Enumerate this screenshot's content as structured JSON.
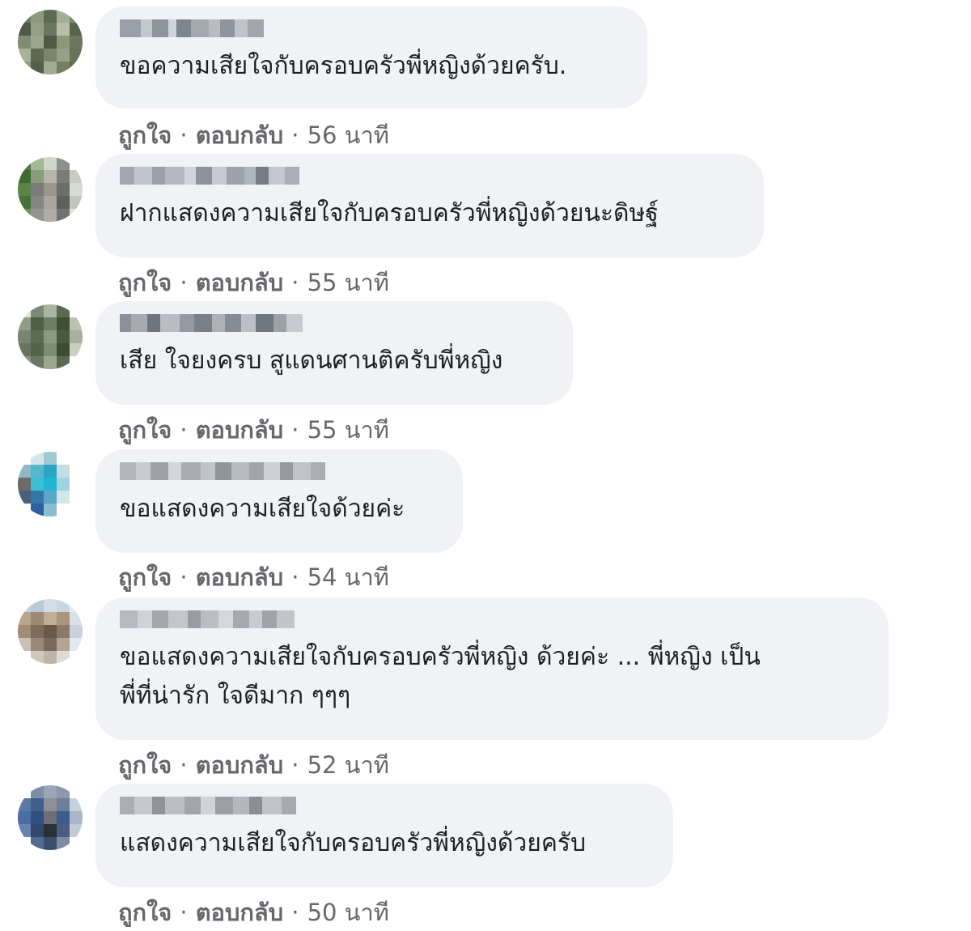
{
  "comments": [
    {
      "text": "ขอความเสียใจกับครอบครัวพี่หญิงด้วยครับ.",
      "like_label": "ถูกใจ",
      "reply_label": "ตอบกลับ",
      "separator": "·",
      "time": "56 นาที"
    },
    {
      "text": "ฝากแสดงความเสียใจกับครอบครัวพี่หญิงด้วยนะดิษฐ์",
      "like_label": "ถูกใจ",
      "reply_label": "ตอบกลับ",
      "separator": "·",
      "time": "55 นาที"
    },
    {
      "text": "เสีย ใจยงครบ สูแดนศานติครับพี่หญิง",
      "like_label": "ถูกใจ",
      "reply_label": "ตอบกลับ",
      "separator": "·",
      "time": "55 นาที"
    },
    {
      "text": "ขอแสดงความเสียใจด้วยค่ะ",
      "like_label": "ถูกใจ",
      "reply_label": "ตอบกลับ",
      "separator": "·",
      "time": "54 นาที"
    },
    {
      "text": "ขอแสดงความเสียใจกับครอบครัวพี่หญิง ด้วยค่ะ ... พี่หญิง เป็น\nพี่ที่น่ารัก ใจดีมาก ๆๆๆ",
      "like_label": "ถูกใจ",
      "reply_label": "ตอบกลับ",
      "separator": "·",
      "time": "52 นาที"
    },
    {
      "text": "แสดงความเสียใจกับครอบครัวพี่หญิงด้วยครับ",
      "like_label": "ถูกใจ",
      "reply_label": "ตอบกลับ",
      "separator": "·",
      "time": "50 นาที"
    }
  ],
  "colors": {
    "bubble_bg": "#f0f2f5",
    "text": "#1c1e21",
    "meta": "#65676b"
  }
}
